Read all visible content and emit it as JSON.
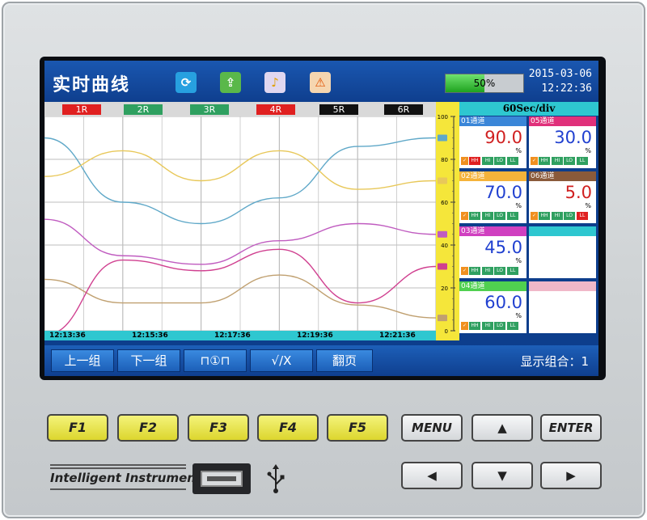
{
  "screen": {
    "title": "实时曲线",
    "progress_label": "50%",
    "progress_value": 0.5,
    "date": "2015-03-06",
    "time": "12:22:36",
    "toolbar_icons": [
      "refresh-icon",
      "usb-icon",
      "bell-icon",
      "warning-icon"
    ]
  },
  "channel_tags": [
    {
      "label": "1R",
      "bg": "#e02020",
      "fg": "#ffffff"
    },
    {
      "label": "2R",
      "bg": "#2fa060",
      "fg": "#ffffff"
    },
    {
      "label": "3R",
      "bg": "#2fa060",
      "fg": "#ffffff"
    },
    {
      "label": "4R",
      "bg": "#e02020",
      "fg": "#ffffff"
    },
    {
      "label": "5R",
      "bg": "#111111",
      "fg": "#ffffff"
    },
    {
      "label": "6R",
      "bg": "#111111",
      "fg": "#ffffff"
    }
  ],
  "time_axis": [
    "12:13:36",
    "12:15:36",
    "12:17:36",
    "12:19:36",
    "12:21:36"
  ],
  "scale": {
    "ticks": [
      "100",
      "80",
      "60",
      "40",
      "20",
      "0"
    ]
  },
  "time_per_div": "60Sec/div",
  "chart_data": {
    "type": "line",
    "x": [
      "12:13:36",
      "12:15:36",
      "12:17:36",
      "12:19:36",
      "12:21:36"
    ],
    "ylim": [
      0,
      100
    ],
    "series": [
      {
        "name": "01通道",
        "color": "#5fa8c8",
        "values": [
          90,
          60,
          50,
          62,
          86,
          90
        ]
      },
      {
        "name": "02通道",
        "color": "#e8c85a",
        "values": [
          72,
          84,
          70,
          84,
          66,
          70
        ]
      },
      {
        "name": "03通道",
        "color": "#c05cc0",
        "values": [
          52,
          35,
          31,
          42,
          50,
          45
        ]
      },
      {
        "name": "04通道",
        "color": "#c0a070",
        "values": [
          24,
          13,
          13,
          26,
          12,
          6
        ]
      },
      {
        "name": "05通道",
        "color": "#d04090",
        "values": [
          -2,
          33,
          28,
          38,
          13,
          30
        ]
      }
    ]
  },
  "channels": [
    {
      "head": "01通道",
      "value": "90.0",
      "unit": "%",
      "head_bg": "#3a86d8",
      "value_color": "#d02020",
      "alarms": [
        "HH",
        "HI",
        "LO",
        "LL"
      ],
      "alarm_on": [
        1,
        0,
        0,
        0
      ]
    },
    {
      "head": "05通道",
      "value": "30.0",
      "unit": "%",
      "head_bg": "#e0307a",
      "value_color": "#2040d0",
      "alarms": [
        "HH",
        "HI",
        "LO",
        "LL"
      ],
      "alarm_on": [
        0,
        0,
        0,
        0
      ]
    },
    {
      "head": "02通道",
      "value": "70.0",
      "unit": "%",
      "head_bg": "#f5b33a",
      "value_color": "#2040d0",
      "alarms": [
        "HH",
        "HI",
        "LO",
        "LL"
      ],
      "alarm_on": [
        0,
        0,
        0,
        0
      ]
    },
    {
      "head": "06通道",
      "value": "5.0",
      "unit": "%",
      "head_bg": "#8a5a3a",
      "value_color": "#d02020",
      "alarms": [
        "HH",
        "HI",
        "LO",
        "LL"
      ],
      "alarm_on": [
        0,
        0,
        0,
        1
      ]
    },
    {
      "head": "03通道",
      "value": "45.0",
      "unit": "%",
      "head_bg": "#d040c0",
      "value_color": "#2040d0",
      "alarms": [
        "HH",
        "HI",
        "LO",
        "LL"
      ],
      "alarm_on": [
        0,
        0,
        0,
        0
      ]
    },
    {
      "head": "04通道",
      "value": "60.0",
      "unit": "%",
      "head_bg": "#50d050",
      "value_color": "#2040d0",
      "alarms": [
        "HH",
        "HI",
        "LO",
        "LL"
      ],
      "alarm_on": [
        0,
        0,
        0,
        0
      ]
    }
  ],
  "softkeys": {
    "prev_group": "上一组",
    "next_group": "下一组",
    "locate": "⊓①⊓",
    "confirm": "√/X",
    "page": "翻页",
    "combo": "显示组合：1"
  },
  "hardware": {
    "f_keys": [
      "F1",
      "F2",
      "F3",
      "F4",
      "F5"
    ],
    "menu": "MENU",
    "enter": "ENTER",
    "up": "▲",
    "down": "▼",
    "left": "◀",
    "right": "▶",
    "brand": "Intelligent Instrument"
  }
}
